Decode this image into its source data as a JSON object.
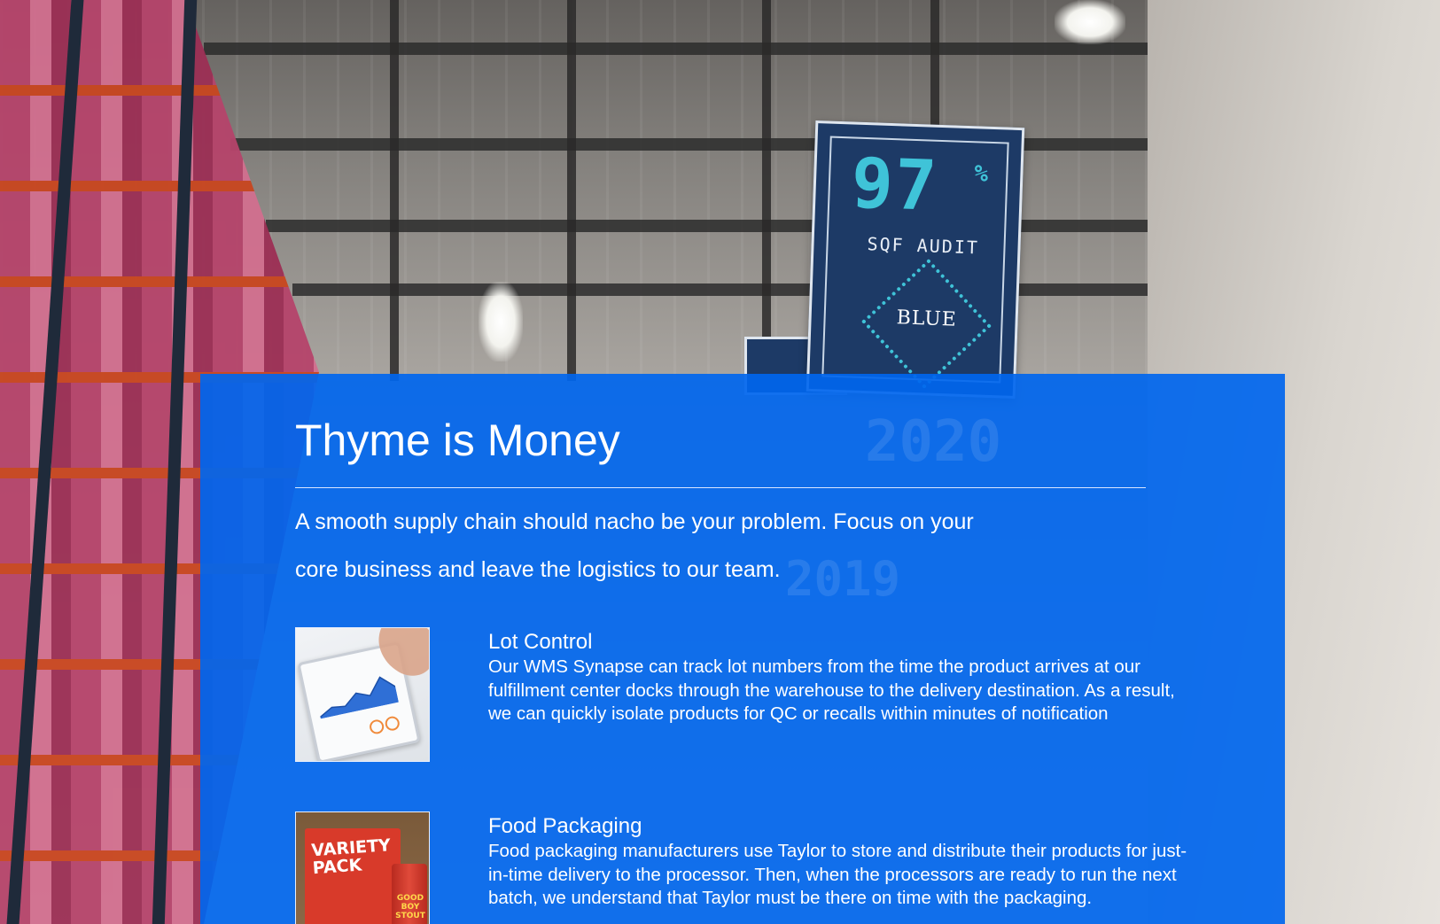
{
  "hero": {
    "title": "Thyme is Money",
    "intro": "A smooth supply chain should nacho be your problem. Focus on your core business and leave the logistics to our team."
  },
  "features": [
    {
      "title": "Lot Control",
      "body": "Our WMS Synapse can track lot numbers from the time the product arrives at our fulfillment center docks through the warehouse to the delivery destination. As a result, we can quickly isolate products for QC or recalls within minutes of notification",
      "image_label": "VARIETY PACK"
    },
    {
      "title": "Food Packaging",
      "body": "Food packaging manufacturers use Taylor to store and distribute their products for just-in-time delivery to the processor. Then, when the processors are ready to run the next batch, we understand that Taylor must be there on time with the packaging."
    }
  ],
  "background": {
    "banner_value": "97",
    "banner_unit": "%",
    "banner_caption": "SQF AUDIT",
    "banner_logo": "BLUE"
  },
  "colors": {
    "panel": "#0066ee",
    "text": "#ffffff",
    "rule": "#d9e6ff"
  }
}
